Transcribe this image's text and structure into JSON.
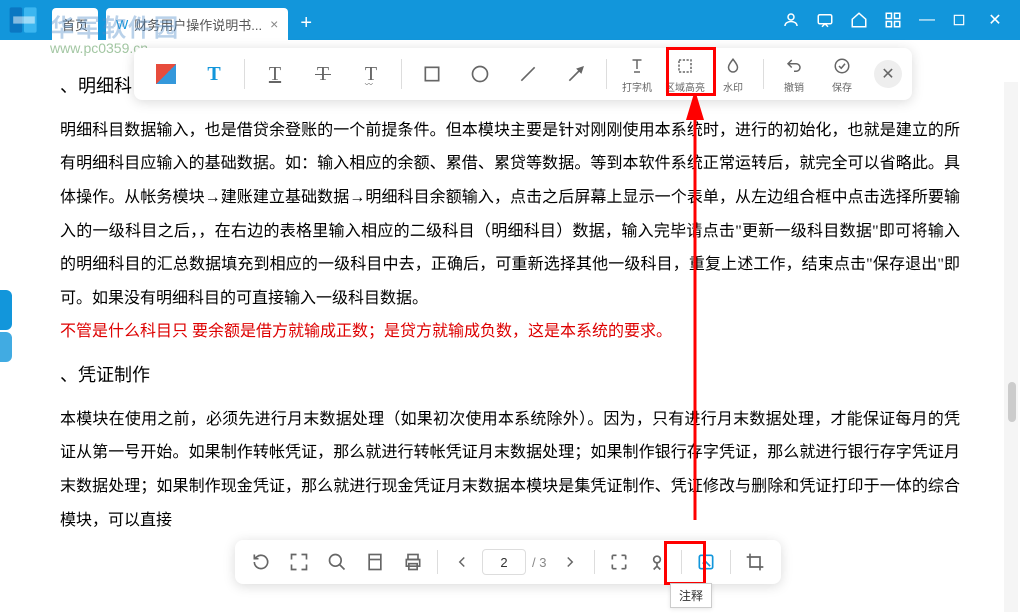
{
  "tabs": {
    "home": "首页",
    "doc": "财务用户操作说明书..."
  },
  "watermark": {
    "text": "华军软件园",
    "url": "www.pc0359.cn"
  },
  "annoToolbar": {
    "typer": "打字机",
    "highlight": "区域高亮",
    "watermark": "水印",
    "undo": "撤销",
    "save": "保存"
  },
  "doc": {
    "h1": "、明细科",
    "p1": "明细科目数据输入，也是借贷余登账的一个前提条件。但本模块主要是针对刚刚使用本系统时，进行的初始化，也就是建立的所有明细科目应输入的基础数据。如：输入相应的余额、累借、累贷等数据。等到本软件系统正常运转后，就完全可以省略此。具体操作。从帐务模块→建账建立基础数据→明细科目余额输入，点击之后屏幕上显示一个表单，从左边组合框中点击选择所要输入的一级科目之后，，在右边的表格里输入相应的二级科目（明细科目）数据，输入完毕请点击\"更新一级科目数据\"即可将输入的明细科目的汇总数据填充到相应的一级科目中去，正确后，可重新选择其他一级科目，重复上述工作，结束点击\"保存退出\"即可。如果没有明细科目的可直接输入一级科目数据。",
    "pred": "不管是什么科目只 要余额是借方就输成正数；是贷方就输成负数，这是本系统的要求。",
    "h2": "、凭证制作",
    "p2": "本模块在使用之前，必须先进行月末数据处理（如果初次使用本系统除外）。因为，只有进行月末数据处理，才能保证每月的凭证从第一号开始。如果制作转帐凭证，那么就进行转帐凭证月末数据处理；如果制作银行存字凭证，那么就进行银行存字凭证月末数据处理；如果制作现金凭证，那么就进行现金凭证月末数据本模块是集凭证制作、凭证修改与删除和凭证打印于一体的综合模块，可以直接"
  },
  "bottom": {
    "page": "2",
    "total": "/ 3",
    "annotate_tip": "注释"
  }
}
